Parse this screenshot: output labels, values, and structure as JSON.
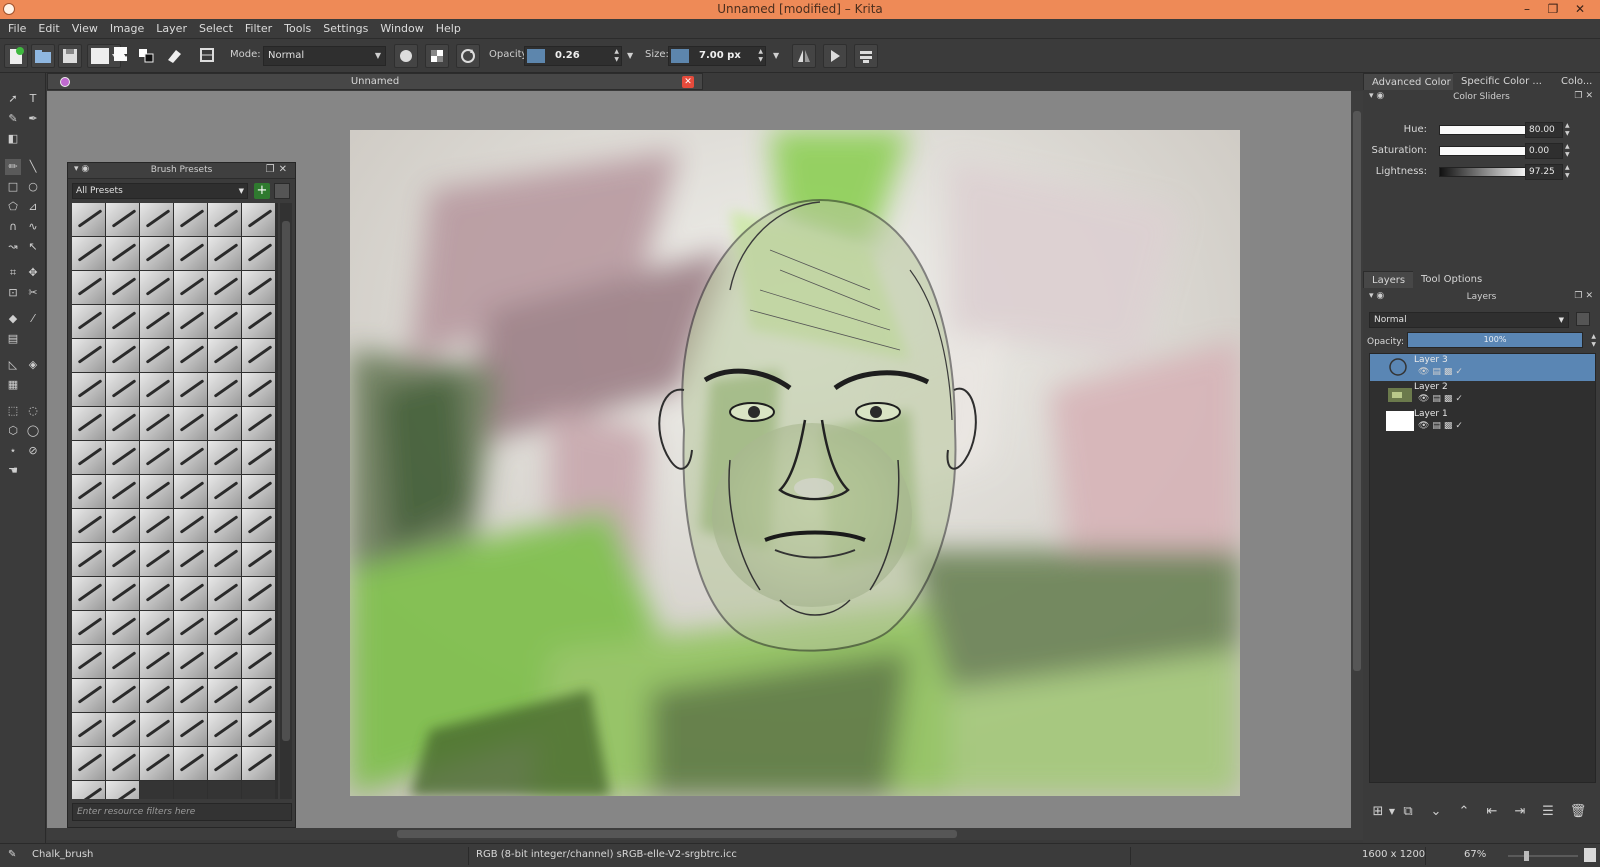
{
  "window": {
    "title": "Unnamed [modified] – Krita",
    "minimize": "–",
    "maximize": "❐",
    "close": "✕"
  },
  "menu": [
    "File",
    "Edit",
    "View",
    "Image",
    "Layer",
    "Select",
    "Filter",
    "Tools",
    "Settings",
    "Window",
    "Help"
  ],
  "toolbar": {
    "mode_label": "Mode:",
    "mode_value": "Normal",
    "opacity_label": "Opacity:",
    "opacity_value": "0.26",
    "size_label": "Size:",
    "size_value": "7.00 px"
  },
  "document": {
    "tab_label": "Unnamed",
    "close": "✕"
  },
  "brush_presets": {
    "title": "Brush Presets",
    "filter_combo": "All Presets",
    "add": "+",
    "filter_placeholder": "Enter resource filters here",
    "preset_count": 104
  },
  "color_docker": {
    "tabs": [
      "Advanced Color ...",
      "Specific Color ...",
      "Colo..."
    ],
    "title": "Color Sliders",
    "sliders": [
      {
        "label": "Hue:",
        "value": "80.00"
      },
      {
        "label": "Saturation:",
        "value": "0.00"
      },
      {
        "label": "Lightness:",
        "value": "97.25"
      }
    ]
  },
  "layers_docker": {
    "tabs": [
      "Layers",
      "Tool Options"
    ],
    "title": "Layers",
    "blend_mode": "Normal",
    "opacity_label": "Opacity:",
    "opacity_value": "100%",
    "layers": [
      {
        "name": "Layer 3",
        "active": true
      },
      {
        "name": "Layer 2",
        "active": false
      },
      {
        "name": "Layer 1",
        "active": false
      }
    ]
  },
  "status": {
    "brush": "Chalk_brush",
    "color_space": "RGB (8-bit integer/channel)  sRGB-elle-V2-srgbtrc.icc",
    "dimensions": "1600 x 1200",
    "zoom": "67%"
  },
  "colors": {
    "titlebar": "#ee8a57",
    "accent": "#5a86b4",
    "panel": "#3b3b3b"
  }
}
